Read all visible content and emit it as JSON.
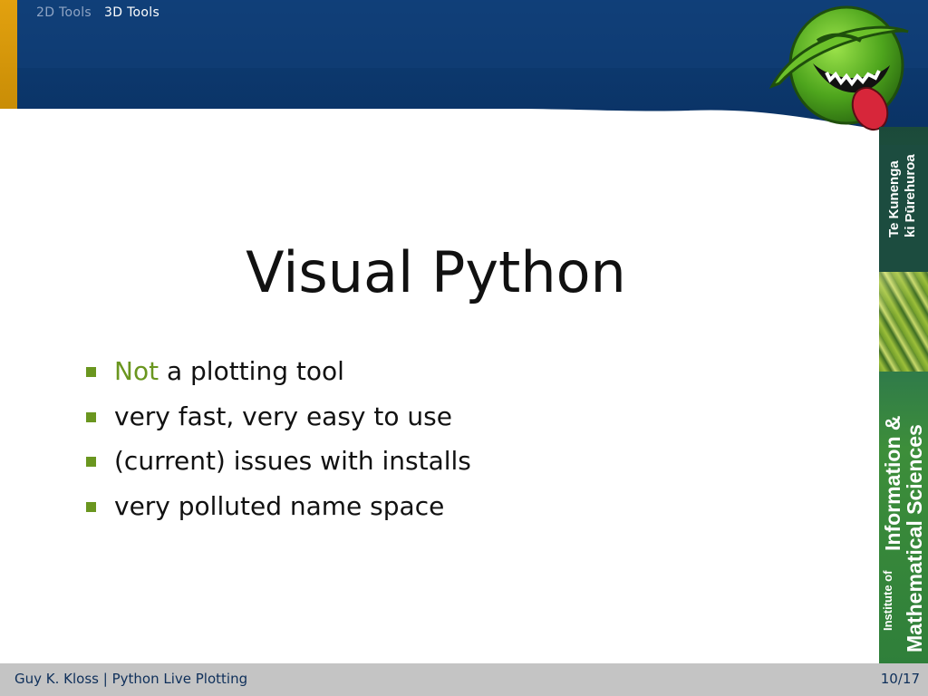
{
  "nav": {
    "items": [
      "2D Tools",
      "3D Tools"
    ],
    "active_index": 1
  },
  "slide": {
    "title": "Visual Python",
    "bullets": [
      {
        "emphasis": "Not",
        "text": " a plotting tool"
      },
      {
        "emphasis": "",
        "text": "very fast, very easy to use"
      },
      {
        "emphasis": "",
        "text": "(current) issues with installs"
      },
      {
        "emphasis": "",
        "text": "very polluted name space"
      }
    ]
  },
  "sidebar": {
    "maori_line1": "Te Kunenga",
    "maori_line2": "ki Pūrehuroa",
    "institute_prefix": "Institute of",
    "institute_line1": "Information &",
    "institute_line2": "Mathematical Sciences"
  },
  "footer": {
    "author": "Guy K. Kloss",
    "separator": "|",
    "talk_title": "Python Live Plotting",
    "page": "10/17"
  },
  "colors": {
    "header_blue": "#0d3a72",
    "accent_gold": "#d89b0a",
    "emphasis_green": "#6a961f",
    "bullet_green": "#6a961f",
    "footer_gray": "#c4c4c4",
    "footer_text": "#0e2f5a"
  },
  "icons": {
    "logo": "alien-mascot-logo",
    "bullet": "square-bullet-icon"
  }
}
